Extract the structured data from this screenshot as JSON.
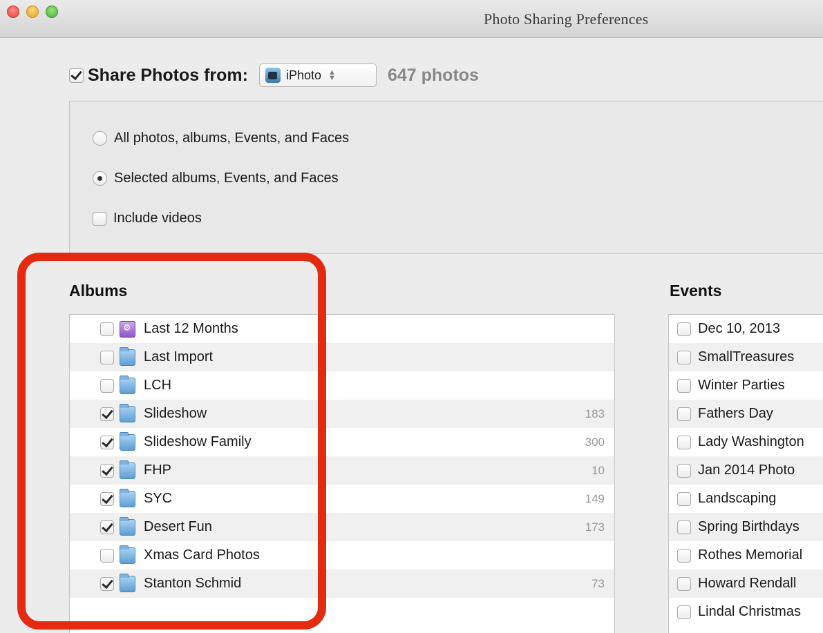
{
  "window": {
    "title": "Photo Sharing Preferences"
  },
  "share": {
    "label": "Share Photos from:",
    "checked": true,
    "source": "iPhoto",
    "count": "647 photos"
  },
  "options": {
    "all": "All photos, albums, Events, and Faces",
    "selected": "Selected albums, Events, and Faces",
    "include_videos": "Include videos",
    "selected_choice": "selected",
    "include_videos_checked": false
  },
  "albums": {
    "title": "Albums",
    "items": [
      {
        "label": "Last 12 Months",
        "checked": false,
        "count": "",
        "icon": "smart-album-icon"
      },
      {
        "label": "Last Import",
        "checked": false,
        "count": "",
        "icon": "album-folder-icon"
      },
      {
        "label": "LCH",
        "checked": false,
        "count": "",
        "icon": "album-folder-icon"
      },
      {
        "label": "Slideshow",
        "checked": true,
        "count": "183",
        "icon": "album-folder-icon"
      },
      {
        "label": "Slideshow Family",
        "checked": true,
        "count": "300",
        "icon": "album-folder-icon"
      },
      {
        "label": "FHP",
        "checked": true,
        "count": "10",
        "icon": "album-folder-icon"
      },
      {
        "label": "SYC",
        "checked": true,
        "count": "149",
        "icon": "album-folder-icon"
      },
      {
        "label": "Desert Fun",
        "checked": true,
        "count": "173",
        "icon": "album-folder-icon"
      },
      {
        "label": "Xmas Card Photos",
        "checked": false,
        "count": "",
        "icon": "album-folder-icon"
      },
      {
        "label": "Stanton Schmid",
        "checked": true,
        "count": "73",
        "icon": "album-folder-icon"
      }
    ]
  },
  "events": {
    "title": "Events",
    "items": [
      {
        "label": "Dec 10, 2013",
        "checked": false
      },
      {
        "label": "SmallTreasures",
        "checked": false
      },
      {
        "label": "Winter Parties",
        "checked": false
      },
      {
        "label": "Fathers Day",
        "checked": false
      },
      {
        "label": "Lady Washington",
        "checked": false
      },
      {
        "label": "Jan 2014 Photo",
        "checked": false
      },
      {
        "label": "Landscaping",
        "checked": false
      },
      {
        "label": "Spring Birthdays",
        "checked": false
      },
      {
        "label": "Rothes Memorial",
        "checked": false
      },
      {
        "label": "Howard Rendall",
        "checked": false
      },
      {
        "label": "Lindal Christmas",
        "checked": false
      }
    ]
  },
  "colors": {
    "highlight": "#e52a12",
    "window_bg": "#ececec"
  }
}
